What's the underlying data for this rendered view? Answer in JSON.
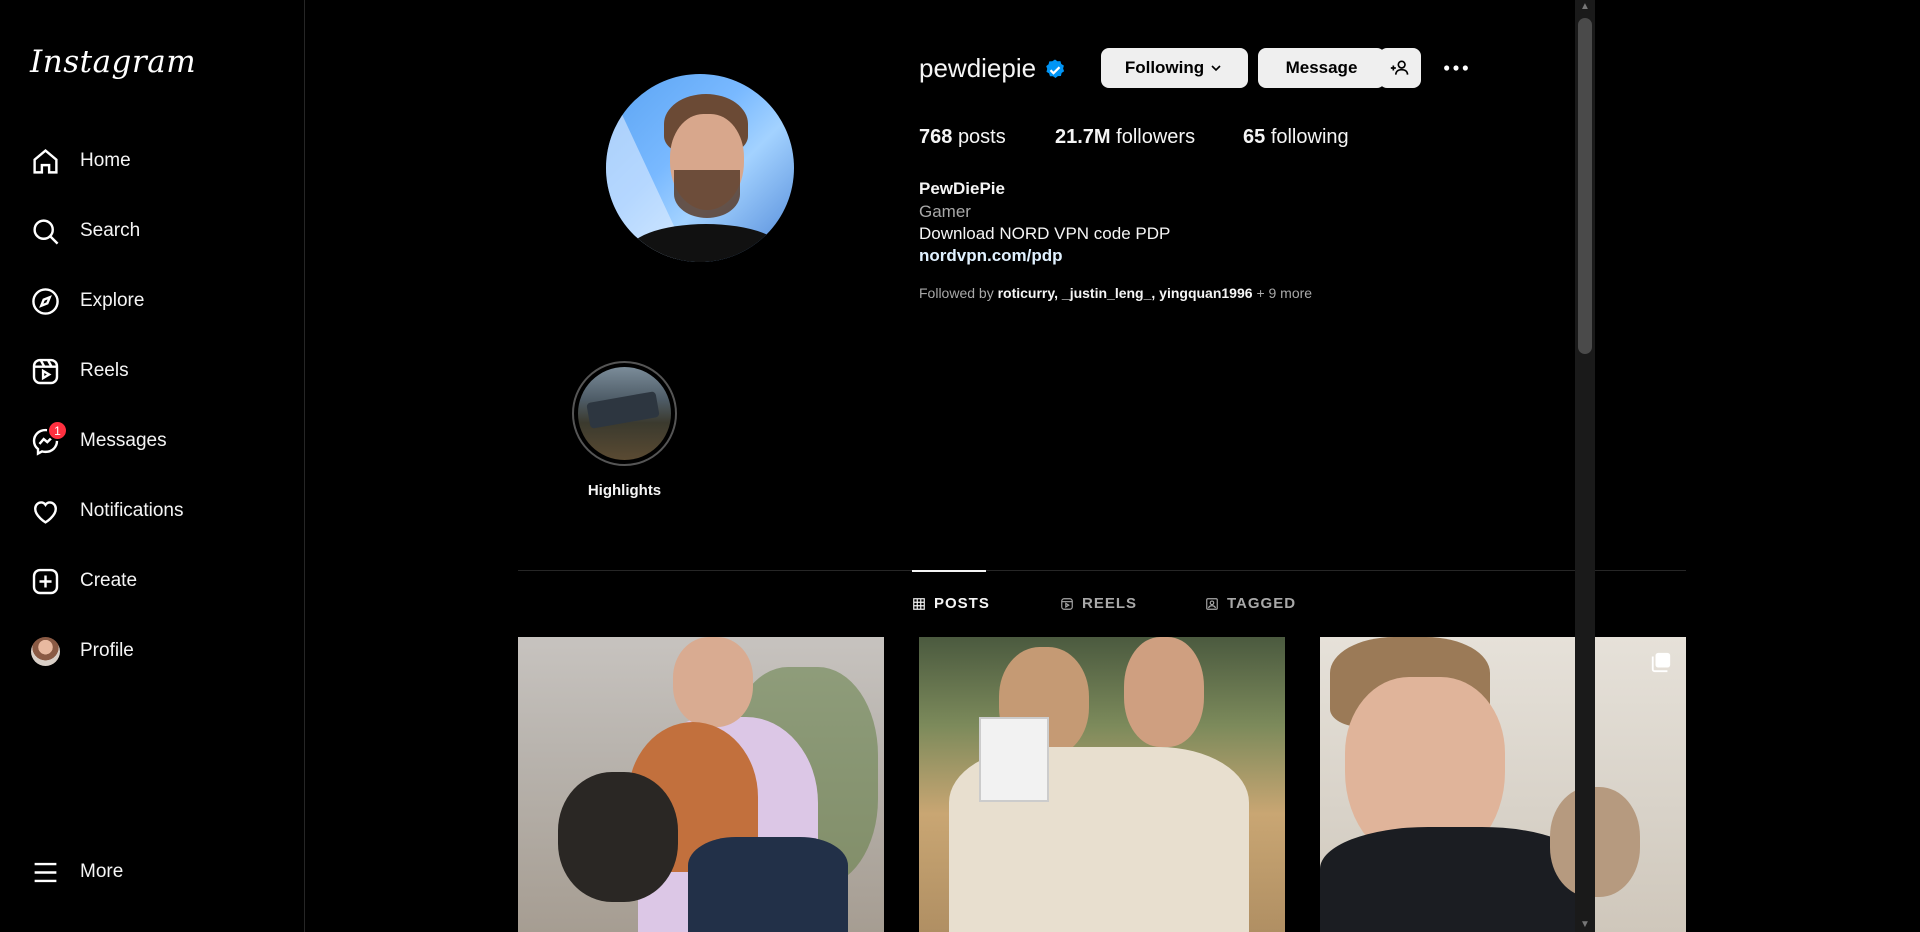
{
  "app": {
    "logo": "Instagram"
  },
  "sidebar": {
    "items": [
      {
        "label": "Home",
        "icon": "home-icon"
      },
      {
        "label": "Search",
        "icon": "search-icon"
      },
      {
        "label": "Explore",
        "icon": "compass-icon"
      },
      {
        "label": "Reels",
        "icon": "reels-icon"
      },
      {
        "label": "Messages",
        "icon": "messenger-icon",
        "badge": "1"
      },
      {
        "label": "Notifications",
        "icon": "heart-icon"
      },
      {
        "label": "Create",
        "icon": "plus-square-icon"
      },
      {
        "label": "Profile",
        "icon": "avatar"
      }
    ],
    "more": "More"
  },
  "profile": {
    "username": "pewdiepie",
    "buttons": {
      "following": "Following",
      "message": "Message"
    },
    "stats": {
      "posts_count": "768",
      "posts_label": "posts",
      "followers_count": "21.7M",
      "followers_label": "followers",
      "following_count": "65",
      "following_label": "following"
    },
    "bio": {
      "name": "PewDiePie",
      "category": "Gamer",
      "text": "Download NORD VPN code PDP",
      "link": "nordvpn.com/pdp"
    },
    "followed_by": {
      "prefix": "Followed by",
      "users": [
        "roticurry",
        "_justin_leng_",
        "yingquan1996"
      ],
      "suffix": "+ 9 more"
    }
  },
  "highlights": [
    {
      "label": "Highlights"
    }
  ],
  "tabs": {
    "posts": "POSTS",
    "reels": "REELS",
    "tagged": "TAGGED"
  },
  "colors": {
    "background": "#000000",
    "badge": "#ff3040",
    "verified": "#0095f6",
    "button": "#efefef"
  }
}
